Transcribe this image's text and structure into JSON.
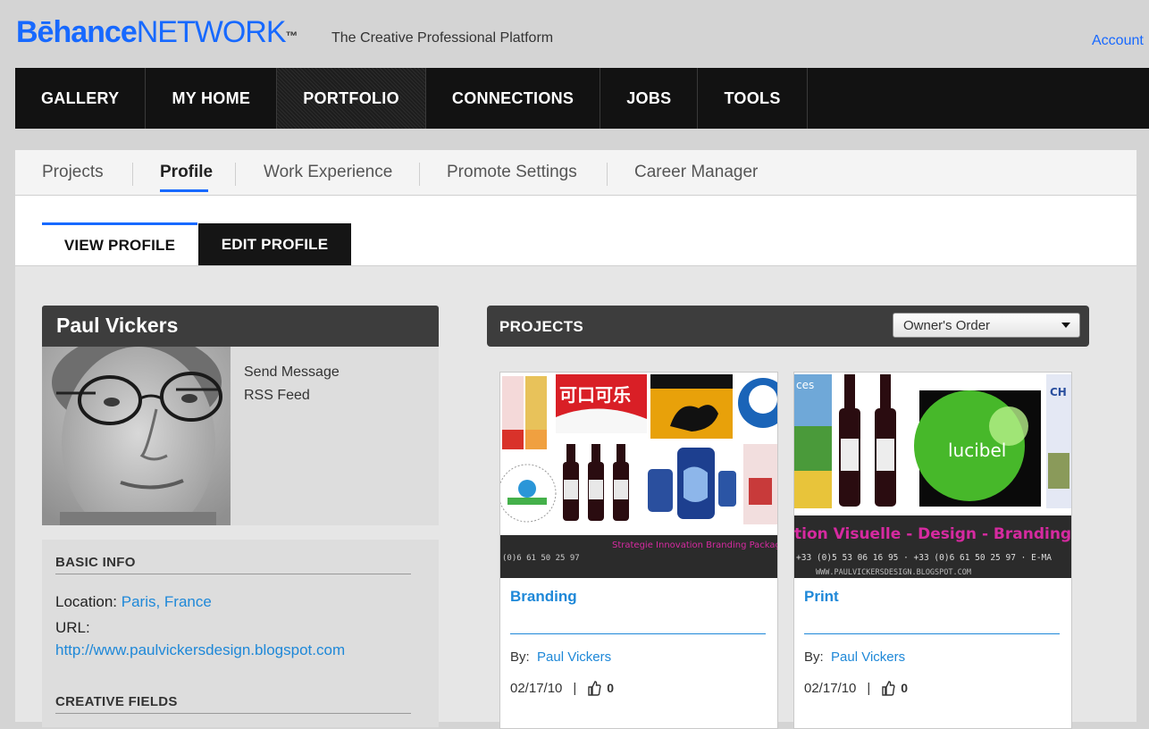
{
  "header": {
    "logo_primary": "Bēhance",
    "logo_secondary": "NETWORK",
    "logo_tm": "™",
    "tagline": "The Creative Professional Platform",
    "account_link": "Account"
  },
  "main_nav": {
    "items": [
      {
        "label": "GALLERY",
        "active": false
      },
      {
        "label": "MY HOME",
        "active": false
      },
      {
        "label": "PORTFOLIO",
        "active": true
      },
      {
        "label": "CONNECTIONS",
        "active": false
      },
      {
        "label": "JOBS",
        "active": false
      },
      {
        "label": "TOOLS",
        "active": false
      }
    ]
  },
  "sub_nav": {
    "items": [
      {
        "label": "Projects",
        "active": false
      },
      {
        "label": "Profile",
        "active": true
      },
      {
        "label": "Work Experience",
        "active": false
      },
      {
        "label": "Promote Settings",
        "active": false
      },
      {
        "label": "Career Manager",
        "active": false
      }
    ]
  },
  "profile_tabs": {
    "view": "VIEW PROFILE",
    "edit": "EDIT PROFILE"
  },
  "profile": {
    "name": "Paul Vickers",
    "send_message": "Send Message",
    "rss_feed": "RSS Feed",
    "basic_info_title": "BASIC INFO",
    "location_label": "Location:",
    "location_value": "Paris, France",
    "url_label": "URL:",
    "url_value": "http://www.paulvickersdesign.blogspot.com",
    "creative_fields_title": "CREATIVE FIELDS"
  },
  "projects": {
    "title": "PROJECTS",
    "sort_selected": "Owner's Order",
    "items": [
      {
        "title": "Branding",
        "by_label": "By:",
        "author": "Paul Vickers",
        "date": "02/17/10",
        "appreciations": "0",
        "thumb_text": {
          "cola": "可口可乐",
          "banner": "Strategie Innovation Branding Packaging",
          "phone": "(0)6 61 50 25 97"
        }
      },
      {
        "title": "Print",
        "by_label": "By:",
        "author": "Paul Vickers",
        "date": "02/17/10",
        "appreciations": "0",
        "thumb_text": {
          "lucibel": "lucibel",
          "banner": "tion Visuelle - Design - Branding",
          "phone": "+33 (0)5 53 06 16 95 · +33 (0)6 61 50 25 97 · E-MA",
          "site": "WWW.PAULVICKERSDESIGN.BLOGSPOT.COM",
          "ces": "ces",
          "ch": "CH"
        }
      }
    ]
  },
  "colors": {
    "brand_blue": "#1769ff",
    "link_blue": "#1e88d8",
    "nav_bg": "#121212",
    "header_bar": "#3d3d3d"
  }
}
